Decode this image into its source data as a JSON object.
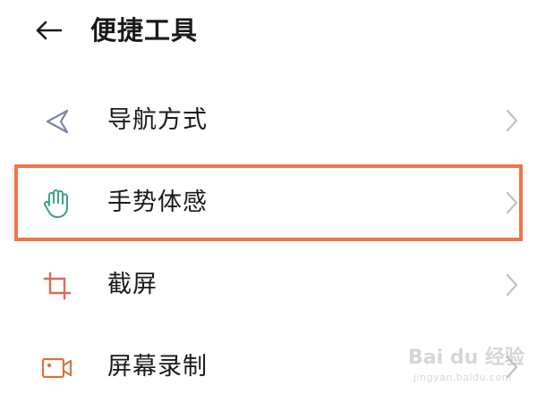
{
  "header": {
    "back_icon": "arrow-left-icon",
    "title": "便捷工具"
  },
  "items": [
    {
      "label": "导航方式",
      "icon": "navigation-arrow-icon",
      "icon_color": "#7b86a6",
      "chevron": "chevron-right-icon"
    },
    {
      "label": "手势体感",
      "icon": "hand-gesture-icon",
      "icon_color": "#3fa37c",
      "chevron": "chevron-right-icon",
      "highlighted": true
    },
    {
      "label": "截屏",
      "icon": "crop-icon",
      "icon_color": "#d96a5a",
      "chevron": "chevron-right-icon"
    },
    {
      "label": "屏幕录制",
      "icon": "video-record-icon",
      "icon_color": "#d9733f",
      "chevron": "chevron-right-icon"
    }
  ],
  "colors": {
    "highlight_border": "#f07648",
    "chevron": "#c4c4c4",
    "text": "#1a1a1a"
  },
  "watermark": {
    "brand": "Bai du 经验",
    "url": "jingyan.baidu.com"
  }
}
